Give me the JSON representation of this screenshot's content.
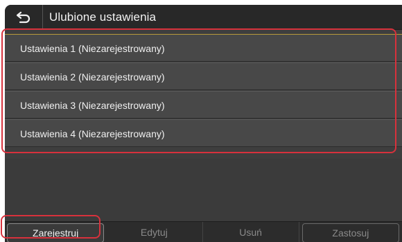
{
  "header": {
    "back_icon": "back-arrow-icon",
    "title": "Ulubione ustawienia"
  },
  "list": {
    "items": [
      {
        "label": "Ustawienia 1 (Niezarejestrowany)"
      },
      {
        "label": "Ustawienia 2 (Niezarejestrowany)"
      },
      {
        "label": "Ustawienia 3 (Niezarejestrowany)"
      },
      {
        "label": "Ustawienia 4 (Niezarejestrowany)"
      }
    ]
  },
  "footer": {
    "register": "Zarejestruj",
    "edit": "Edytuj",
    "delete": "Usuń",
    "apply": "Zastosuj"
  },
  "colors": {
    "highlight": "#d8313c",
    "background": "#3e3e3e"
  }
}
